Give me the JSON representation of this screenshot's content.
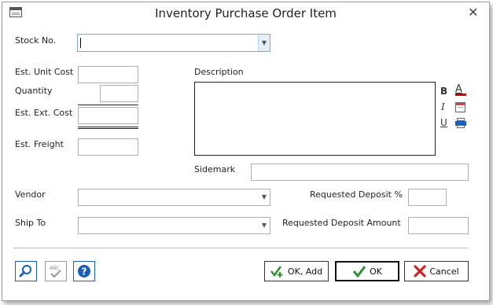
{
  "window": {
    "title": "Inventory Purchase Order Item"
  },
  "form": {
    "stock_no_label": "Stock No.",
    "stock_no_value": "",
    "est_unit_cost_label": "Est. Unit Cost",
    "est_unit_cost_value": "",
    "quantity_label": "Quantity",
    "quantity_value": "",
    "est_ext_cost_label": "Est. Ext. Cost",
    "est_ext_cost_value": "",
    "est_freight_label": "Est. Freight",
    "est_freight_value": "",
    "description_label": "Description",
    "description_value": "",
    "sidemark_label": "Sidemark",
    "sidemark_value": "",
    "vendor_label": "Vendor",
    "vendor_value": "",
    "ship_to_label": "Ship To",
    "ship_to_value": "",
    "requested_deposit_pct_label": "Requested Deposit %",
    "requested_deposit_pct_value": "",
    "requested_deposit_amount_label": "Requested Deposit Amount",
    "requested_deposit_amount_value": ""
  },
  "formatting": {
    "bold_glyph": "B",
    "italic_glyph": "I",
    "underline_glyph": "U",
    "font_color_glyph": "A"
  },
  "buttons": {
    "ok_add_label": "OK, Add",
    "ok_label": "OK",
    "cancel_label": "Cancel"
  },
  "colors": {
    "ok_check": "#2f8f2f",
    "cancel_x": "#d02020",
    "help_blue": "#1a5fb4",
    "font_color_red": "#d00000"
  }
}
